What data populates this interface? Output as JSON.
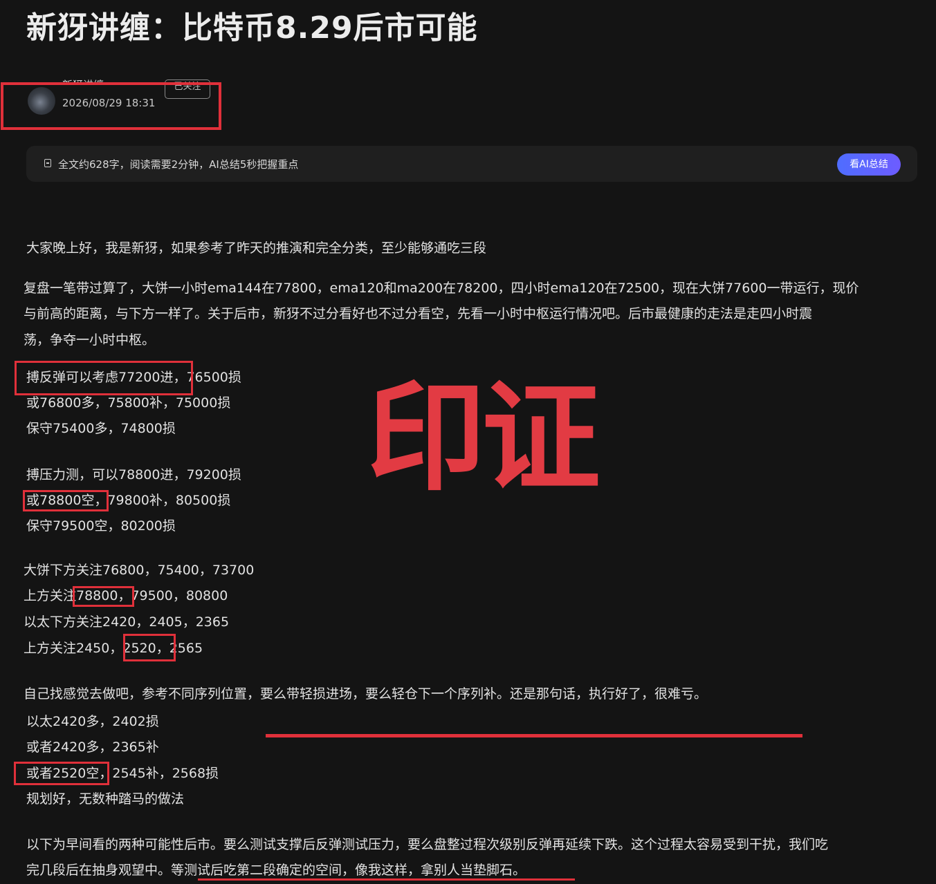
{
  "article": {
    "title": "新犽讲缠：比特币8.29后市可能",
    "author": "新犽讲缠",
    "follow_label": "已关注",
    "post_time": "2026/08/29 18:31"
  },
  "summary_bar": {
    "text": "全文约628字，阅读需要2分钟，AI总结5秒把握重点",
    "ai_button": "看AI总结"
  },
  "body": {
    "greeting": "大家晚上好，我是新犽，如果参考了昨天的推演和完全分类，至少能够通吃三段",
    "review_lines": [
      "复盘一笔带过算了，大饼一小时ema144在77800，ema120和ma200在78200，四小时ema120在72500，现在大饼77600一带运行，现价",
      "与前高的距离，与下方一样了。关于后市，新犽不过分看好也不过分看空，先看一小时中枢运行情况吧。后市最健康的走法是走四小时震",
      "荡，争夺一小时中枢。"
    ],
    "rebound_lines": [
      "搏反弹可以考虑77200进，76500损",
      "或76800多，75800补，75000损",
      "保守75400多，74800损"
    ],
    "pressure_lines": [
      "搏压力测，可以78800进，79200损",
      "或78800空，79800补，80500损",
      "保守79500空，80200损"
    ],
    "levels_lines": [
      "大饼下方关注76800，75400，73700",
      "上方关注78800，79500，80800",
      "以太下方关注2420，2405，2365",
      "上方关注2450，2520，2565"
    ],
    "advice": "自己找感觉去做吧，参考不同序列位置，要么带轻损进场，要么轻仓下一个序列补。还是那句话，执行好了，很难亏。",
    "eth_lines": [
      "以太2420多，2402损",
      "或者2420多，2365补",
      "或者2520空，2545补，2568损",
      "规划好，无数种踏马的做法"
    ],
    "closing_lines": [
      "以下为早间看的两种可能性后市。要么测试支撑后反弹测试压力，要么盘整过程次级别反弹再延续下跌。这个过程太容易受到干扰，我们吃",
      "完几段后在抽身观望中。等测试后吃第二段确定的空间，像我这样，拿别人当垫脚石。"
    ]
  },
  "stamp_text": "印证",
  "annotation_color": "#e0303a"
}
